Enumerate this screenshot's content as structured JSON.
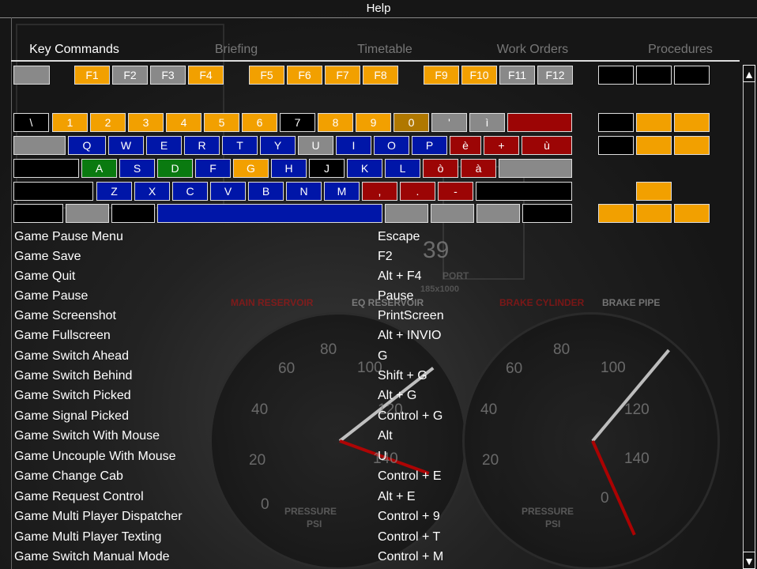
{
  "window": {
    "title": "Help"
  },
  "tabs": [
    "Key Commands",
    "Briefing",
    "Timetable",
    "Work Orders",
    "Procedures"
  ],
  "background": {
    "gauge_labels": [
      "MAIN RESERVOIR",
      "EQ RESERVOIR",
      "BRAKE CYLINDER",
      "BRAKE PIPE"
    ],
    "gauge1_numbers": [
      "40",
      "60",
      "80",
      "100",
      "120",
      "140",
      "20",
      "0"
    ],
    "gauge2_numbers": [
      "40",
      "60",
      "80",
      "100",
      "120",
      "140",
      "20",
      "0"
    ],
    "pressure": "PRESSURE",
    "psi": "PSI",
    "big_number": "39",
    "port": "PORT",
    "scale": "185x1000"
  },
  "keyboard": {
    "fkeys": [
      "F1",
      "F2",
      "F3",
      "F4",
      "F5",
      "F6",
      "F7",
      "F8",
      "F9",
      "F10",
      "F11",
      "F12"
    ],
    "row1": [
      "\\",
      "1",
      "2",
      "3",
      "4",
      "5",
      "6",
      "7",
      "8",
      "9",
      "0",
      "'",
      "ì"
    ],
    "row2": [
      "Q",
      "W",
      "E",
      "R",
      "T",
      "Y",
      "U",
      "I",
      "O",
      "P",
      "è",
      "+",
      "ù"
    ],
    "row3": [
      "A",
      "S",
      "D",
      "F",
      "G",
      "H",
      "J",
      "K",
      "L",
      "ò",
      "à"
    ],
    "row4": [
      "Z",
      "X",
      "C",
      "V",
      "B",
      "N",
      "M",
      ",",
      ".",
      "-"
    ],
    "colors": {
      "assigned": "#f2a000",
      "unassigned": "#898989",
      "blue": "#0016a8",
      "red": "#9c0505",
      "green": "#0a7a10",
      "black": "#000000"
    }
  },
  "commands": [
    {
      "name": "Game Pause Menu",
      "key": "Escape"
    },
    {
      "name": "Game Save",
      "key": "F2"
    },
    {
      "name": "Game Quit",
      "key": "Alt + F4"
    },
    {
      "name": "Game Pause",
      "key": "Pause"
    },
    {
      "name": "Game Screenshot",
      "key": "PrintScreen"
    },
    {
      "name": "Game Fullscreen",
      "key": "Alt + INVIO"
    },
    {
      "name": "Game Switch Ahead",
      "key": "G"
    },
    {
      "name": "Game Switch Behind",
      "key": "Shift + G"
    },
    {
      "name": "Game Switch Picked",
      "key": "Alt + G"
    },
    {
      "name": "Game Signal Picked",
      "key": "Control + G"
    },
    {
      "name": "Game Switch With Mouse",
      "key": "Alt"
    },
    {
      "name": "Game Uncouple With Mouse",
      "key": "U"
    },
    {
      "name": "Game Change Cab",
      "key": "Control + E"
    },
    {
      "name": "Game Request Control",
      "key": "Alt + E"
    },
    {
      "name": "Game Multi Player Dispatcher",
      "key": "Control + 9"
    },
    {
      "name": "Game Multi Player Texting",
      "key": "Control + T"
    },
    {
      "name": "Game Switch Manual Mode",
      "key": "Control + M"
    }
  ],
  "scrollbar": {
    "up": "▲",
    "down": "▼"
  }
}
